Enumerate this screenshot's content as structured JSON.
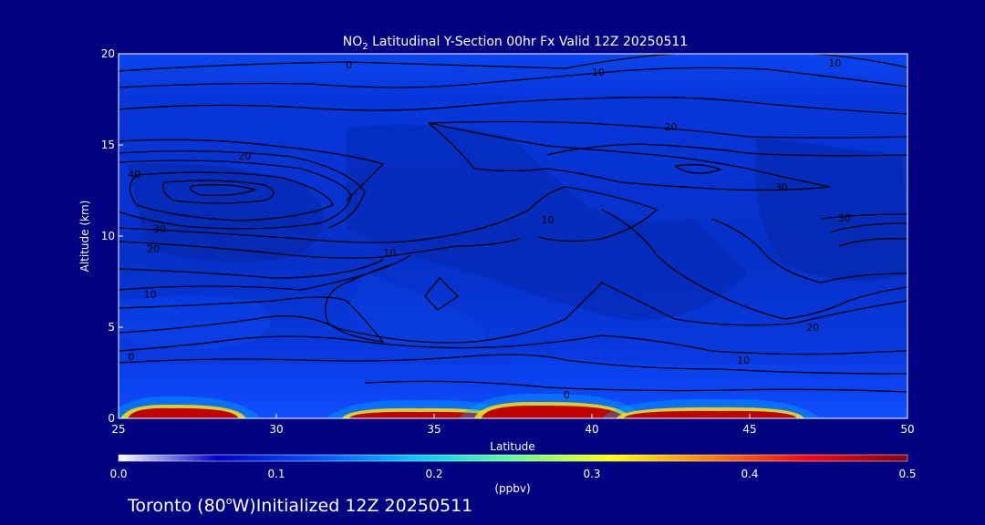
{
  "chart_data": {
    "type": "heatmap",
    "title_prefix": "NO",
    "title_subscript": "2",
    "title_rest": " Latitudinal Y-Section 00hr  Fx Valid 12Z 20250511",
    "xlabel": "Latitude",
    "ylabel": "Altitude (km)",
    "xlim": [
      25,
      50
    ],
    "ylim": [
      0,
      20
    ],
    "x_ticks": [
      "25",
      "30",
      "35",
      "40",
      "45",
      "50"
    ],
    "y_ticks": [
      "0",
      "5",
      "10",
      "15",
      "20"
    ],
    "colorbar": {
      "label": "(ppbv)",
      "range": [
        0.0,
        0.5
      ],
      "ticks": [
        "0.0",
        "0.1",
        "0.2",
        "0.3",
        "0.4",
        "0.5"
      ],
      "colors": [
        "#ffffff",
        "#0000c8",
        "#0050ff",
        "#00c8ff",
        "#60ff90",
        "#ffff00",
        "#ff8000",
        "#ff0000",
        "#800000"
      ]
    },
    "surface_plumes": [
      {
        "lat_from": 25.3,
        "lat_to": 28.8,
        "peak_lat": 26.6,
        "top_km": 0.6,
        "peak_value": 0.5
      },
      {
        "lat_from": 32.3,
        "lat_to": 37.0,
        "peak_lat": 34.5,
        "top_km": 0.4,
        "peak_value": 0.45
      },
      {
        "lat_from": 36.5,
        "lat_to": 41.0,
        "peak_lat": 38.3,
        "top_km": 0.75,
        "peak_value": 0.5
      },
      {
        "lat_from": 41.0,
        "lat_to": 46.5,
        "peak_lat": 44.0,
        "top_km": 0.45,
        "peak_value": 0.45
      }
    ],
    "contour_labels": [
      {
        "text": "0",
        "lat": 32.3,
        "alt": 19.4
      },
      {
        "text": "10",
        "lat": 40.2,
        "alt": 19.0
      },
      {
        "text": "10",
        "lat": 47.7,
        "alt": 19.5
      },
      {
        "text": "20",
        "lat": 42.5,
        "alt": 16.0
      },
      {
        "text": "20",
        "lat": 29.0,
        "alt": 14.4
      },
      {
        "text": "40",
        "lat": 25.5,
        "alt": 13.4
      },
      {
        "text": "30",
        "lat": 46.0,
        "alt": 12.7
      },
      {
        "text": "30",
        "lat": 48.0,
        "alt": 11.0
      },
      {
        "text": "30",
        "lat": 26.3,
        "alt": 10.4
      },
      {
        "text": "20",
        "lat": 26.1,
        "alt": 9.3
      },
      {
        "text": "10",
        "lat": 38.6,
        "alt": 10.9
      },
      {
        "text": "10",
        "lat": 33.6,
        "alt": 9.1
      },
      {
        "text": "10",
        "lat": 26.0,
        "alt": 6.8
      },
      {
        "text": "20",
        "lat": 47.0,
        "alt": 5.0
      },
      {
        "text": "10",
        "lat": 44.8,
        "alt": 3.2
      },
      {
        "text": "0",
        "lat": 25.4,
        "alt": 3.4
      },
      {
        "text": "0",
        "lat": 39.2,
        "alt": 1.3
      }
    ]
  },
  "footer": {
    "location": "Toronto (80",
    "degree": "o",
    "location_rest": "W)Initialized 12Z 20250511"
  }
}
